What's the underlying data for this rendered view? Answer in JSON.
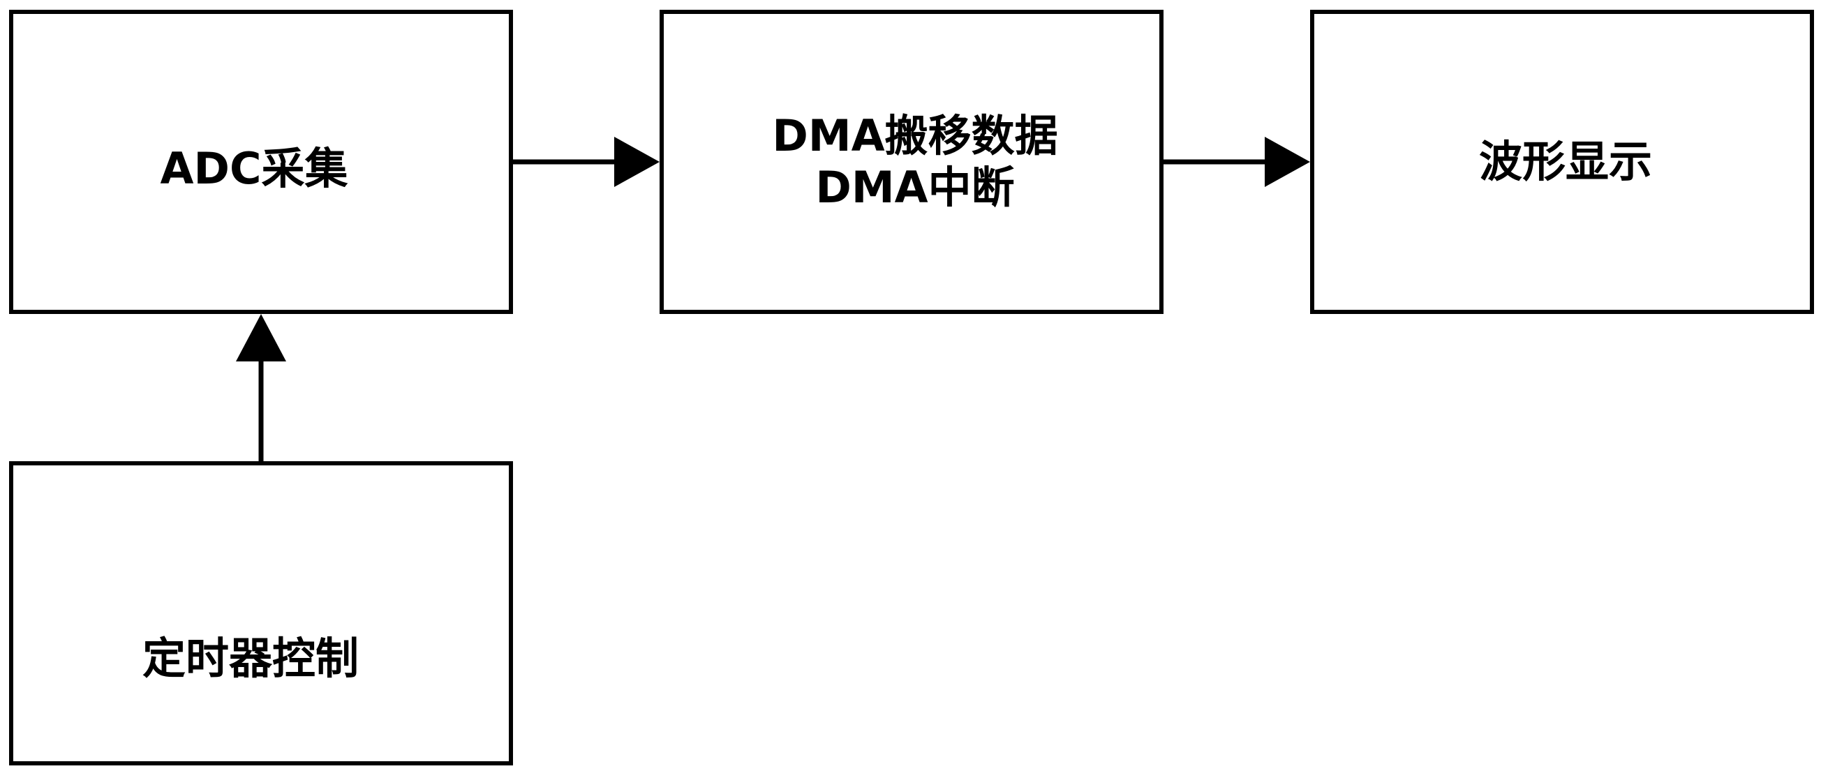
{
  "nodes": {
    "adc": {
      "label": "ADC采集"
    },
    "dma": {
      "line1": "DMA搬移数据",
      "line2": "DMA中断"
    },
    "wave": {
      "label": "波形显示"
    },
    "timer": {
      "label": "定时器控制"
    }
  },
  "edges": [
    {
      "from": "adc",
      "to": "dma"
    },
    {
      "from": "dma",
      "to": "wave"
    },
    {
      "from": "timer",
      "to": "adc"
    }
  ],
  "colors": {
    "stroke": "#000000",
    "background": "#ffffff"
  }
}
